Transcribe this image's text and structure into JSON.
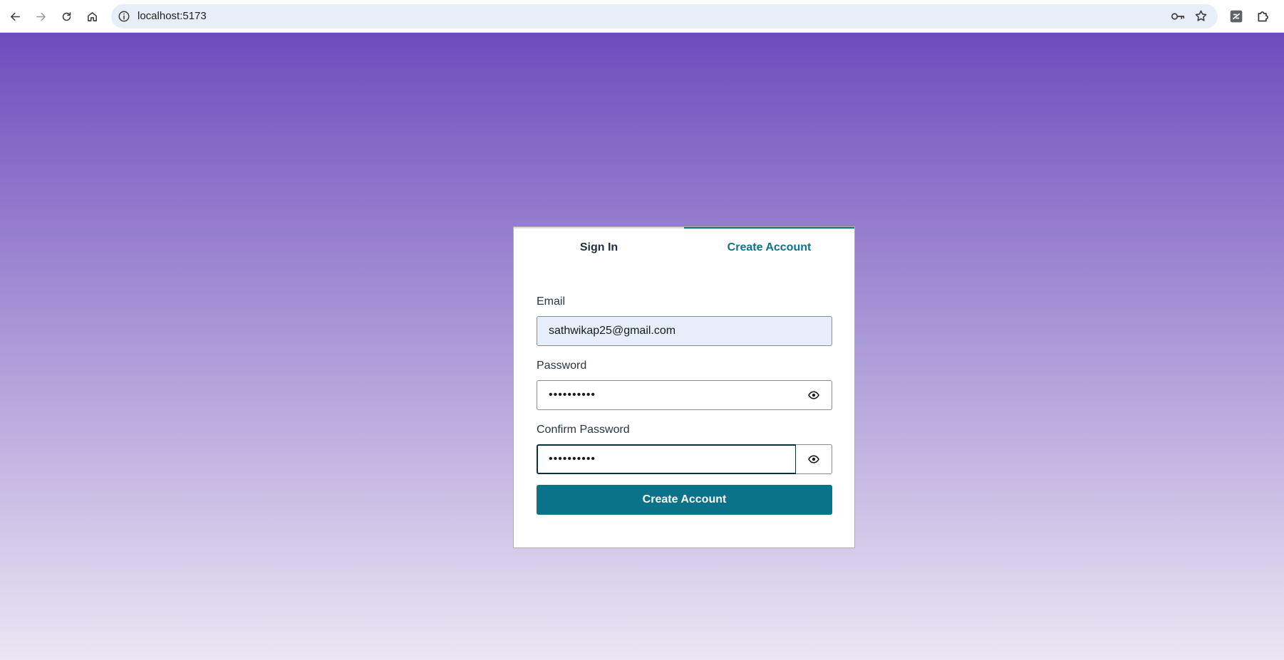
{
  "browser": {
    "url": "localhost:5173",
    "icons": {
      "back": "arrow-left-icon",
      "forward": "arrow-right-icon",
      "reload": "reload-icon",
      "home": "home-icon",
      "site_info": "info-icon",
      "passwords": "key-icon",
      "bookmark": "star-icon",
      "extension": "extension-icon",
      "extensions_menu": "puzzle-icon"
    }
  },
  "auth": {
    "tabs": [
      {
        "label": "Sign In",
        "active": false
      },
      {
        "label": "Create Account",
        "active": true
      }
    ],
    "email": {
      "label": "Email",
      "value": "sathwikap25@gmail.com"
    },
    "password": {
      "label": "Password",
      "value": "••••••••••"
    },
    "confirm_password": {
      "label": "Confirm Password",
      "value": "••••••••••"
    },
    "submit_label": "Create Account"
  },
  "colors": {
    "accent": "#0b7389",
    "gradient_top": "#6e4cbc",
    "gradient_bottom": "#ebe6f4",
    "email_autofill_bg": "#e6eefb"
  }
}
